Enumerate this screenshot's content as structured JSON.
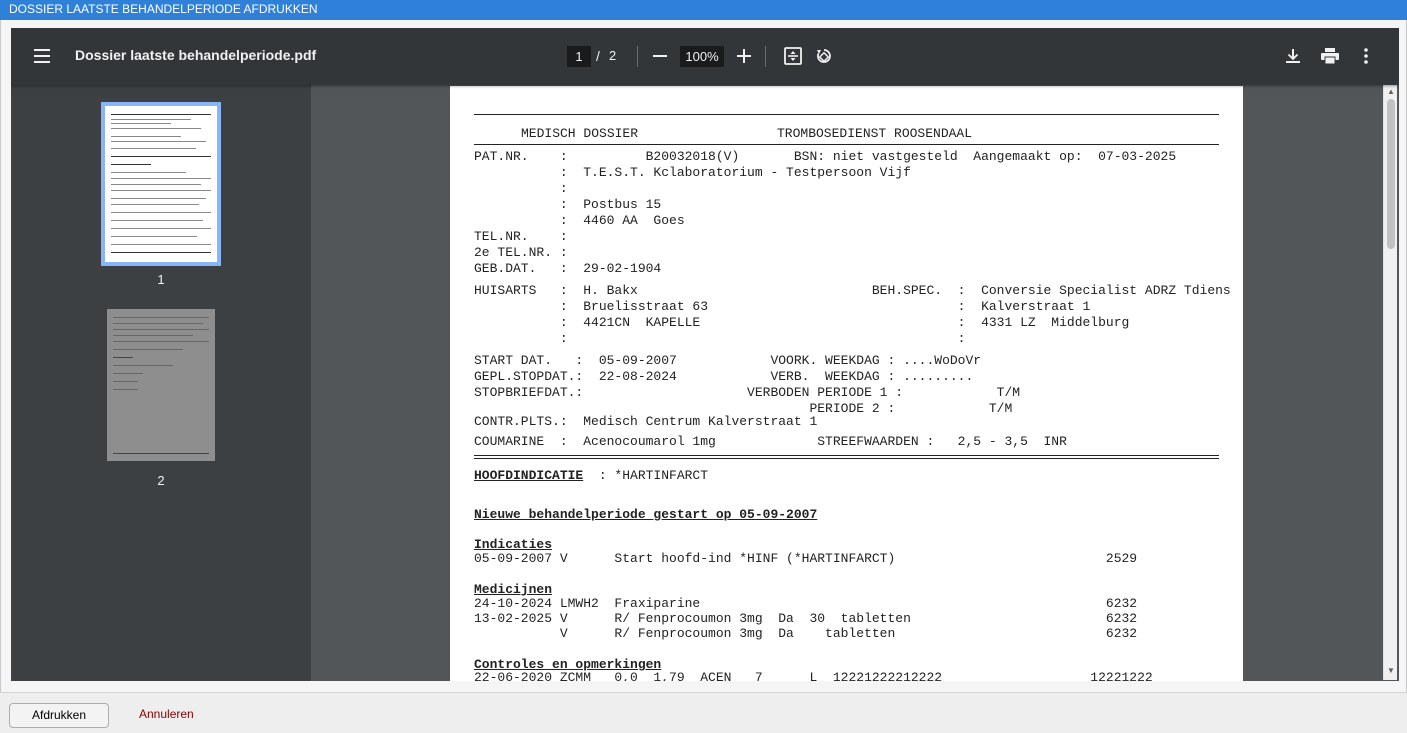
{
  "window": {
    "title": "DOSSIER LAATSTE BEHANDELPERIODE AFDRUKKEN"
  },
  "viewer": {
    "file_name": "Dossier laatste behandelperiode.pdf",
    "current_page": "1",
    "page_separator": "/",
    "total_pages": "2",
    "zoom": "100%",
    "icons": [
      "menu-icon",
      "zoom-out-icon",
      "zoom-in-icon",
      "fit-page-icon",
      "rotate-icon",
      "download-icon",
      "print-icon",
      "more-vert-icon"
    ]
  },
  "thumbnails": [
    {
      "label": "1",
      "selected": true
    },
    {
      "label": "2",
      "selected": false
    }
  ],
  "document": {
    "header_left": "MEDISCH DOSSIER",
    "header_right": "TROMBOSEDIENST ROOSENDAAL",
    "patient_lines": [
      "PAT.NR.    :          B20032018(V)       BSN: niet vastgesteld  Aangemaakt op:  07-03-2025",
      "           :  T.E.S.T. Kclaboratorium - Testpersoon Vijf",
      "           :",
      "           :  Postbus 15",
      "           :  4460 AA  Goes",
      "TEL.NR.    :",
      "2e TEL.NR. :",
      "GEB.DAT.   :  29-02-1904"
    ],
    "huisarts_lines": [
      "HUISARTS   :  H. Bakx                              BEH.SPEC.  :  Conversie Specialist ADRZ Tdiens",
      "           :  Bruelisstraat 63                                :  Kalverstraat 1",
      "           :  4421CN  KAPELLE                                 :  4331 LZ  Middelburg",
      "           :                                                  :"
    ],
    "treatment_lines": [
      "START DAT.   :  05-09-2007            VOORK. WEEKDAG : ....WoDoVr",
      "GEPL.STOPDAT.:  22-08-2024            VERB.  WEEKDAG : .........",
      "STOPBRIEFDAT.:                     VERBODEN PERIODE 1 :            T/M",
      "                                           PERIODE 2 :            T/M"
    ],
    "contr_line": "CONTR.PLTS.:  Medisch Centrum Kalverstraat 1",
    "coumarine_line": "COUMARINE  :  Acenocoumarol 1mg             STREEFWAARDEN :   2,5 - 3,5  INR",
    "hoofdindicatie_label": "HOOFDINDICATIE",
    "hoofdindicatie_value": "  : *HARTINFARCT",
    "period_heading": "Nieuwe behandelperiode gestart op 05-09-2007",
    "indicaties_heading": "Indicaties",
    "indicaties_lines": [
      "05-09-2007 V      Start hoofd-ind *HINF (*HARTINFARCT)                           2529"
    ],
    "medicijnen_heading": "Medicijnen",
    "medicijnen_lines": [
      "24-10-2024 LMWH2  Fraxiparine                                                    6232",
      "13-02-2025 V      R/ Fenprocoumon 3mg  Da  30  tabletten                         6232",
      "           V      R/ Fenprocoumon 3mg  Da    tabletten                           6232"
    ],
    "controles_heading": "Controles en opmerkingen",
    "controles_lines": [
      "22-06-2020 ZCMM   0,0  1,79  ACEN   7      L  12221222212222                   12221222"
    ]
  },
  "footer": {
    "print_label": "Afdrukken",
    "cancel_label": "Annuleren"
  },
  "colors": {
    "titlebar": "#2f80d8",
    "toolbar": "#323639",
    "viewer_bg": "#525659",
    "sidebar": "#3c4043",
    "thumb_selected": "#8ab4f8",
    "cancel_text": "#8b0000"
  }
}
